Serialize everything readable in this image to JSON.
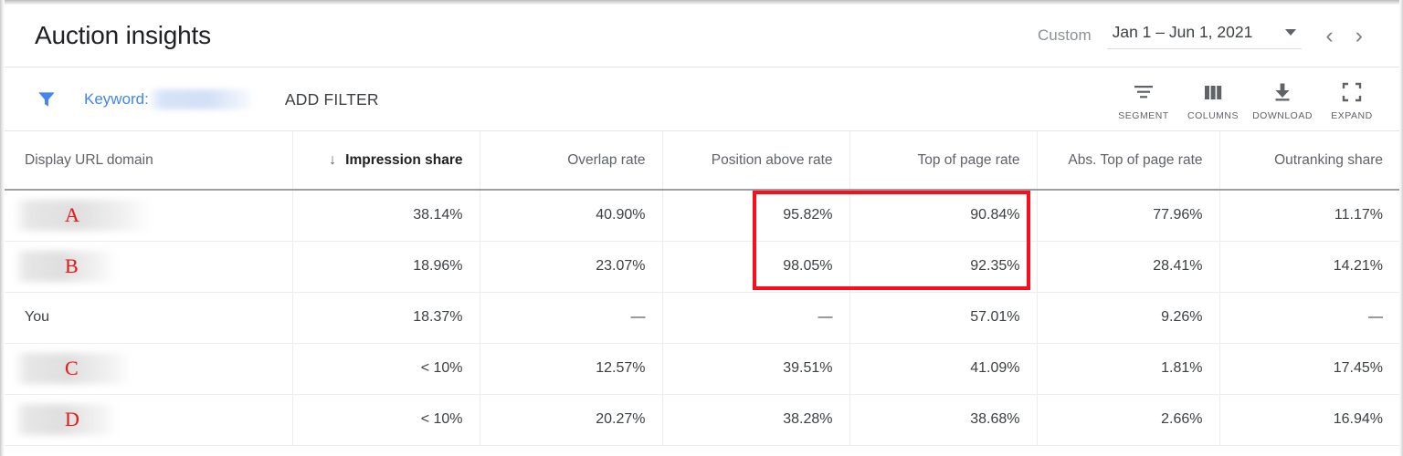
{
  "window": {
    "title": "Auction insights"
  },
  "date_range": {
    "preset_label": "Custom",
    "value": "Jan 1 – Jun 1, 2021",
    "dropdown_icon": "chevron-down-icon",
    "prev_icon": "chevron-left-icon",
    "prev_glyph": "‹",
    "next_icon": "chevron-right-icon",
    "next_glyph": "›"
  },
  "filter_bar": {
    "funnel_icon": "filter-funnel-icon",
    "keyword_label": "Keyword:",
    "keyword_value_redacted": "",
    "add_filter_label": "ADD FILTER",
    "tools": [
      {
        "label": "SEGMENT",
        "icon": "segment-icon"
      },
      {
        "label": "COLUMNS",
        "icon": "columns-icon"
      },
      {
        "label": "DOWNLOAD",
        "icon": "download-icon"
      },
      {
        "label": "EXPAND",
        "icon": "expand-icon"
      }
    ]
  },
  "table": {
    "sort": {
      "column": "Impression share",
      "direction": "desc",
      "arrow_glyph": "↓"
    },
    "columns": [
      "Display URL domain",
      "Impression share",
      "Overlap rate",
      "Position above rate",
      "Top of page rate",
      "Abs. Top of page rate",
      "Outranking share"
    ],
    "rows": [
      {
        "domain_label": "A",
        "domain_redacted": true,
        "impression_share": "38.14%",
        "overlap_rate": "40.90%",
        "position_above_rate": "95.82%",
        "top_of_page_rate": "90.84%",
        "abs_top_of_page_rate": "77.96%",
        "outranking_share": "11.17%"
      },
      {
        "domain_label": "B",
        "domain_redacted": true,
        "impression_share": "18.96%",
        "overlap_rate": "23.07%",
        "position_above_rate": "98.05%",
        "top_of_page_rate": "92.35%",
        "abs_top_of_page_rate": "28.41%",
        "outranking_share": "14.21%"
      },
      {
        "domain_label": "You",
        "domain_redacted": false,
        "impression_share": "18.37%",
        "overlap_rate": "—",
        "position_above_rate": "—",
        "top_of_page_rate": "57.01%",
        "abs_top_of_page_rate": "9.26%",
        "outranking_share": "—"
      },
      {
        "domain_label": "C",
        "domain_redacted": true,
        "impression_share": "< 10%",
        "overlap_rate": "12.57%",
        "position_above_rate": "39.51%",
        "top_of_page_rate": "41.09%",
        "abs_top_of_page_rate": "1.81%",
        "outranking_share": "17.45%"
      },
      {
        "domain_label": "D",
        "domain_redacted": true,
        "impression_share": "< 10%",
        "overlap_rate": "20.27%",
        "position_above_rate": "38.28%",
        "top_of_page_rate": "38.68%",
        "abs_top_of_page_rate": "2.66%",
        "outranking_share": "16.94%"
      }
    ]
  },
  "annotation": {
    "highlight_color": "#fc0d1b",
    "highlight_note": "red rectangle around Position above rate and Top of page rate for rows A and B"
  }
}
